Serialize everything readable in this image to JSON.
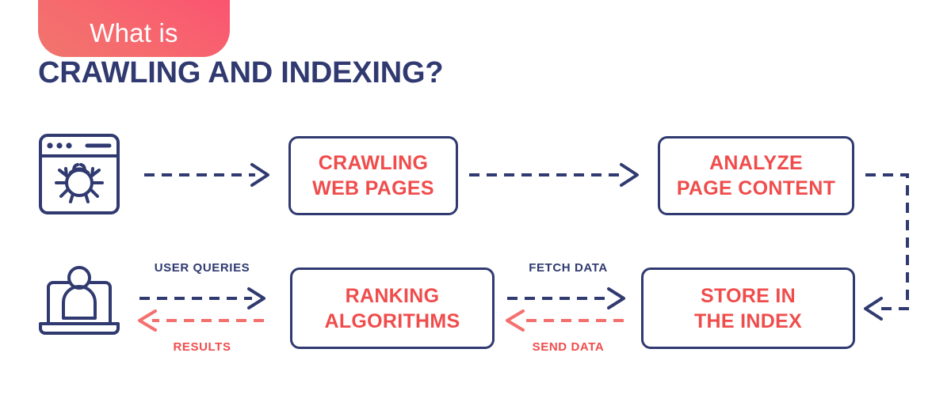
{
  "header": {
    "badge_text": "What is",
    "title": "CRAWLING AND INDEXING?"
  },
  "colors": {
    "navy": "#303a70",
    "coral": "#f04c4c",
    "badge_gradient_start": "#f0756d",
    "badge_gradient_end": "#fa5370",
    "background": "#ffffff"
  },
  "icons": {
    "crawler": {
      "name": "browser-bug-icon",
      "description": "Browser window containing a bug (web crawler)"
    },
    "user": {
      "name": "laptop-user-icon",
      "description": "Laptop with a person representing the search user"
    }
  },
  "nodes": [
    {
      "id": "crawling",
      "line1": "CRAWLING",
      "line2": "WEB PAGES"
    },
    {
      "id": "analyze",
      "line1": "ANALYZE",
      "line2": "PAGE CONTENT"
    },
    {
      "id": "ranking",
      "line1": "RANKING",
      "line2": "ALGORITHMS"
    },
    {
      "id": "store",
      "line1": "STORE IN",
      "line2": "THE INDEX"
    }
  ],
  "connectors": [
    {
      "id": "crawler-to-crawling",
      "label": "",
      "style": "dashed",
      "color": "#303a70",
      "direction": "right"
    },
    {
      "id": "crawling-to-analyze",
      "label": "",
      "style": "dashed",
      "color": "#303a70",
      "direction": "right"
    },
    {
      "id": "analyze-to-store",
      "label": "",
      "style": "dashed",
      "color": "#303a70",
      "direction": "elbow-right-down-left"
    },
    {
      "id": "user-queries",
      "label": "USER QUERIES",
      "style": "dashed",
      "color": "#303a70",
      "direction": "right"
    },
    {
      "id": "results",
      "label": "RESULTS",
      "style": "dashed",
      "color": "#f04c4c",
      "direction": "left"
    },
    {
      "id": "fetch-data",
      "label": "FETCH DATA",
      "style": "dashed",
      "color": "#303a70",
      "direction": "right"
    },
    {
      "id": "send-data",
      "label": "SEND DATA",
      "style": "dashed",
      "color": "#f04c4c",
      "direction": "left"
    }
  ],
  "labels": {
    "user_queries": "USER QUERIES",
    "results": "RESULTS",
    "fetch_data": "FETCH DATA",
    "send_data": "SEND DATA"
  }
}
